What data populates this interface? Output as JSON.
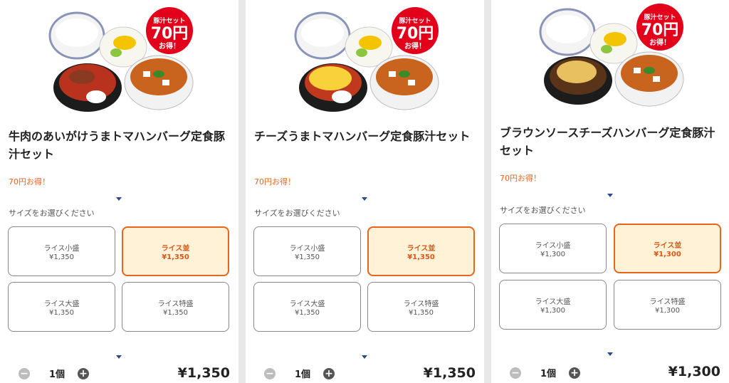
{
  "colors": {
    "accent": "#e8651e",
    "selected_bg": "#fff2d6",
    "caret": "#2a4a8a",
    "badge": "#e2001a"
  },
  "badge": {
    "top": "豚汁セット",
    "value": "70円",
    "bottom": "お得！"
  },
  "panels": [
    {
      "title": "牛肉のあいがけうまトマハンバーグ定食豚汁セット",
      "promo": "70円お得！",
      "prompt": "サイズをお選びください",
      "options": [
        {
          "name": "ライス小盛",
          "price": "¥1,350"
        },
        {
          "name": "ライス並",
          "price": "¥1,350"
        },
        {
          "name": "ライス大盛",
          "price": "¥1,350"
        },
        {
          "name": "ライス特盛",
          "price": "¥1,350"
        }
      ],
      "quantity": "1個",
      "total": "¥1,350"
    },
    {
      "title": "チーズうまトマハンバーグ定食豚汁セット",
      "promo": "70円お得！",
      "prompt": "サイズをお選びください",
      "options": [
        {
          "name": "ライス小盛",
          "price": "¥1,350"
        },
        {
          "name": "ライス並",
          "price": "¥1,350"
        },
        {
          "name": "ライス大盛",
          "price": "¥1,350"
        },
        {
          "name": "ライス特盛",
          "price": "¥1,350"
        }
      ],
      "quantity": "1個",
      "total": "¥1,350"
    },
    {
      "title": "ブラウンソースチーズハンバーグ定食豚汁セット",
      "promo": "70円お得！",
      "prompt": "サイズをお選びください",
      "options": [
        {
          "name": "ライス小盛",
          "price": "¥1,300"
        },
        {
          "name": "ライス並",
          "price": "¥1,300"
        },
        {
          "name": "ライス大盛",
          "price": "¥1,300"
        },
        {
          "name": "ライス特盛",
          "price": "¥1,300"
        }
      ],
      "quantity": "1個",
      "total": "¥1,300"
    }
  ]
}
